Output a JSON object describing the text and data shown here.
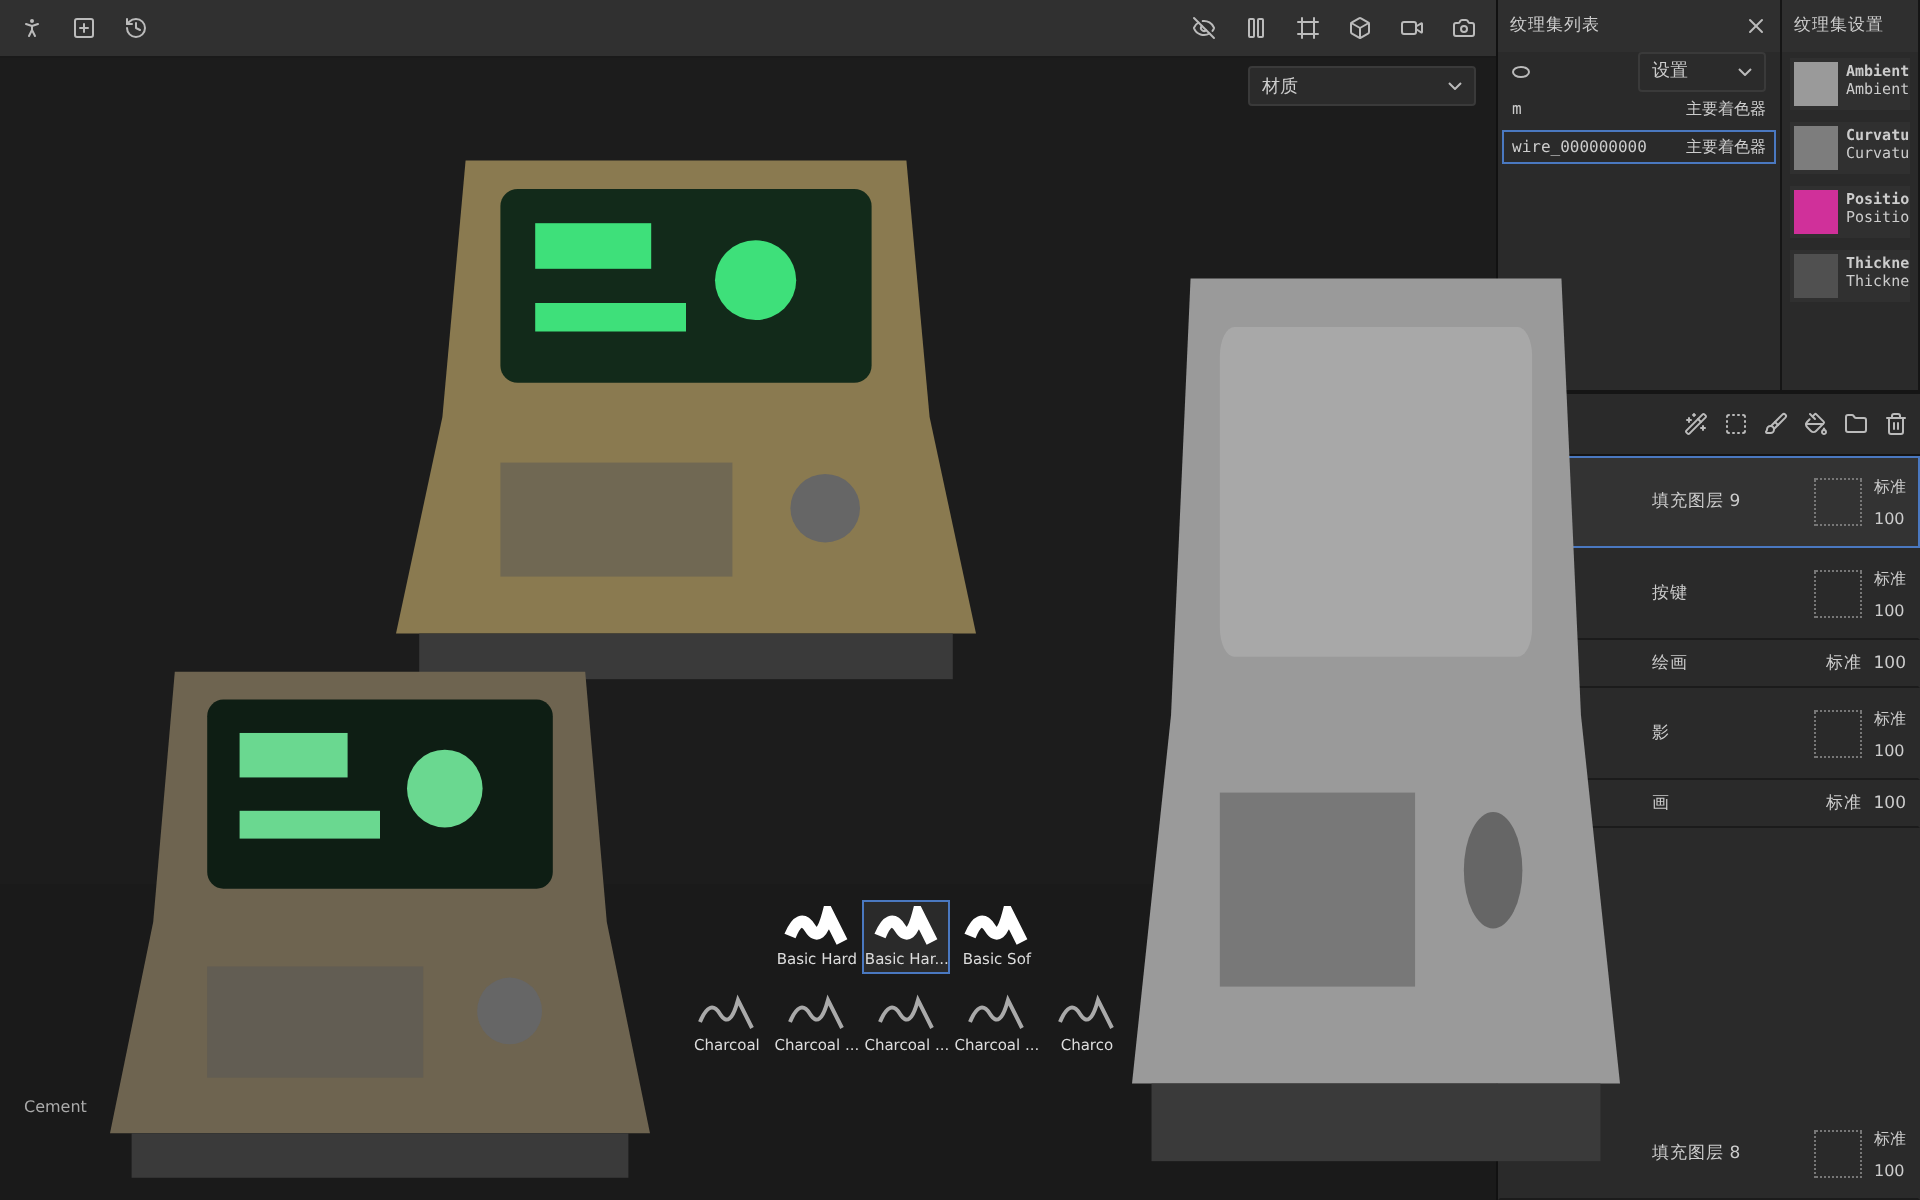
{
  "viewport": {
    "material_dropdown": "材质"
  },
  "texture_set_list": {
    "title": "纹理集列表",
    "dropdown": "设置",
    "rows": [
      {
        "name": "m",
        "shader": "主要着色器",
        "selected": false
      },
      {
        "name": "wire_000000000",
        "shader": "主要着色器",
        "selected": true
      }
    ]
  },
  "texture_set_settings": {
    "title": "纹理集设置",
    "bakes": [
      {
        "name": "Ambient",
        "sub": "Ambient",
        "color": "#9a9a9a"
      },
      {
        "name": "Curvatu",
        "sub": "Curvatu",
        "color": "#7d7d7d"
      },
      {
        "name": "Positio",
        "sub": "Positio",
        "color": "#d0309a"
      },
      {
        "name": "Thickne",
        "sub": "Thickne",
        "color": "#505050"
      }
    ]
  },
  "layers": [
    {
      "kind": "fill",
      "name": "填充图层 9",
      "blend": "标准",
      "opacity": "100",
      "selected": true
    },
    {
      "kind": "fill",
      "name": "按键",
      "blend": "标准",
      "opacity": "100",
      "selected": false
    },
    {
      "kind": "paint",
      "name": "绘画",
      "blend": "标准",
      "opacity": "100",
      "selected": false
    },
    {
      "kind": "fill",
      "name": "影",
      "blend": "标准",
      "opacity": "100",
      "selected": false
    },
    {
      "kind": "paint",
      "name": "画",
      "blend": "标准",
      "opacity": "100",
      "selected": false
    }
  ],
  "layers_bottom": [
    {
      "kind": "fill",
      "name": "填充图层 8",
      "blend": "标准",
      "opacity": "100",
      "selected": false
    }
  ],
  "brushes": [
    {
      "label": "Basic Hard",
      "selected": false
    },
    {
      "label": "Basic Har...",
      "selected": true
    },
    {
      "label": "Basic Sof",
      "selected": false
    },
    {
      "label": "Charcoal",
      "selected": false
    },
    {
      "label": "Charcoal ...",
      "selected": false
    },
    {
      "label": "Charcoal ...",
      "selected": false
    },
    {
      "label": "Charcoal ...",
      "selected": false
    },
    {
      "label": "Charco",
      "selected": false
    }
  ],
  "cement_label": "Cement"
}
